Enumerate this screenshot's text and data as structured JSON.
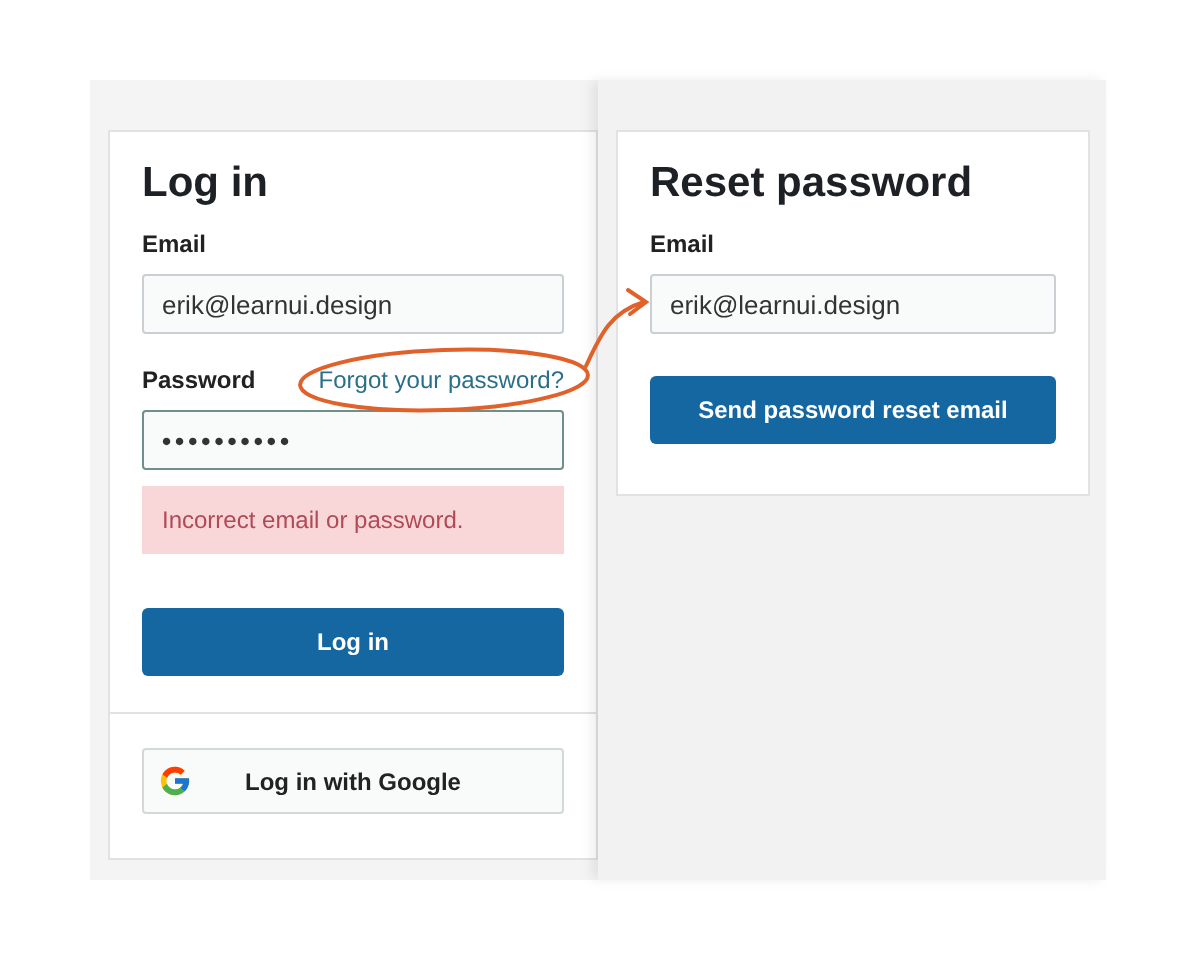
{
  "login": {
    "title": "Log in",
    "email": {
      "label": "Email",
      "value": "erik@learnui.design",
      "focused": false
    },
    "password": {
      "label": "Password",
      "value": "••••••••••",
      "focused": true
    },
    "forgot_link": "Forgot your password?",
    "error": "Incorrect email or password.",
    "submit": "Log in",
    "google": "Log in with Google"
  },
  "reset": {
    "title": "Reset password",
    "email": {
      "label": "Email",
      "value": "erik@learnui.design",
      "focused": false
    },
    "submit": "Send password reset email"
  }
}
